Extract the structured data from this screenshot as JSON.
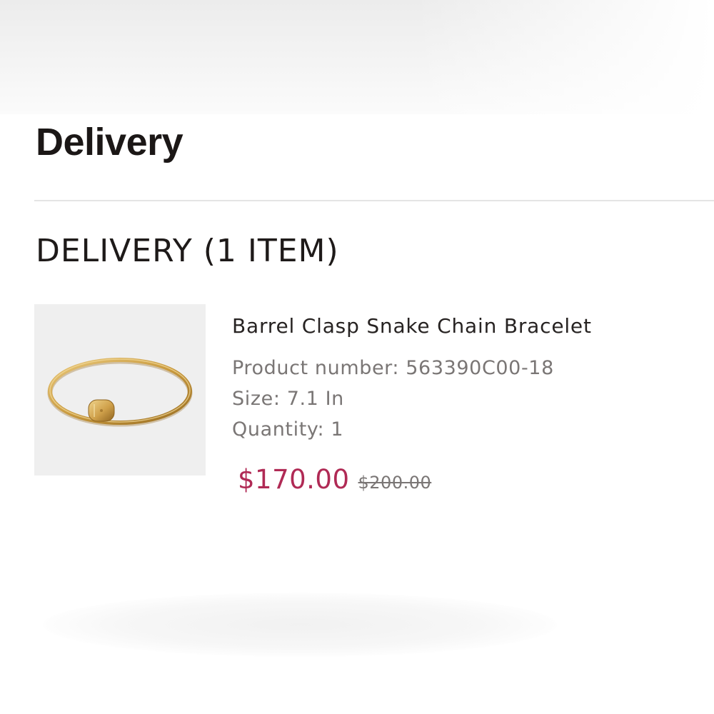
{
  "header": {
    "title": "Delivery"
  },
  "delivery_section": {
    "title": "DELIVERY (1 ITEM)"
  },
  "item": {
    "name": "Barrel Clasp Snake Chain Bracelet",
    "product_number": "Product number: 563390C00-18",
    "size": "Size: 7.1 In",
    "quantity": "Quantity: 1",
    "sale_price": "$170.00",
    "original_price": "$200.00",
    "image_icon": "gold-bracelet-icon"
  },
  "colors": {
    "sale_price": "#b02a55",
    "text_primary": "#1b1716",
    "text_secondary": "#7a7675",
    "thumbnail_background": "#efefef",
    "bracelet_gold": "#c99a3e"
  }
}
